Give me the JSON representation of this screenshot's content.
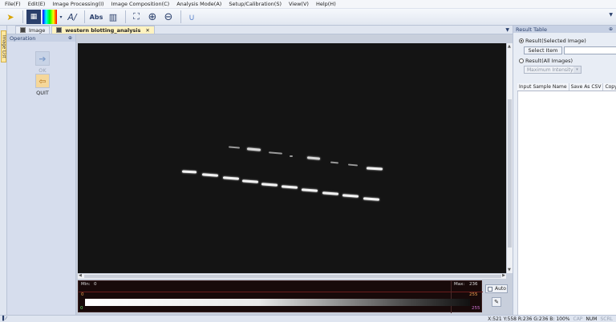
{
  "menu": [
    "File(F)",
    "Edit(E)",
    "Image Processing(I)",
    "Image Composition(C)",
    "Analysis Mode(A)",
    "Setup/Calibration(S)",
    "View(V)",
    "Help(H)"
  ],
  "toolbar": {
    "abs_label": "Abs"
  },
  "side_tab": {
    "label": "Image List"
  },
  "tabs": [
    {
      "label": "Image"
    },
    {
      "label": "western blotting_analysis",
      "close": "✕"
    }
  ],
  "operation": {
    "title": "Operation",
    "ok_label": "OK",
    "quit_label": "QUIT"
  },
  "histogram": {
    "min_label": "Min:",
    "min_value": "0",
    "max_label": "Max:",
    "max_value": "236",
    "left_low": "0",
    "left_high": "255",
    "bottom_left": "0",
    "bottom_right": "255",
    "auto_label": "Auto"
  },
  "result": {
    "title": "Result Table",
    "radio_selected": "Result(Selected Image)",
    "select_item": "Select Item",
    "radio_all": "Result(All Images)",
    "dropdown_value": "Maximum Intensity",
    "columns": [
      "Input Sample Name",
      "Save As CSV",
      "Copy"
    ]
  },
  "status": {
    "coords": "X:521  Y:558  R:236 G:236 B: 100%",
    "cap": "CAP",
    "num": "NUM",
    "scrl": "SCRL"
  },
  "colors": {
    "accent": "#2a3f6b",
    "canvas": "#141414",
    "active_tab": "#fff3c0"
  }
}
